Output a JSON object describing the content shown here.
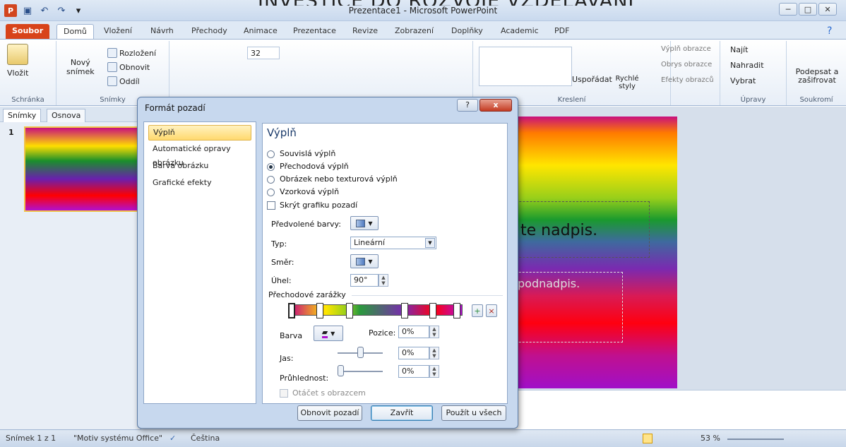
{
  "overlay": {
    "text": "INVESTICE DO ROZVOJE VZDĚLÁVÁNÍ"
  },
  "window": {
    "title": "Prezentace1 - Microsoft PowerPoint",
    "app_icon": "P"
  },
  "tabs": [
    {
      "label": "Soubor"
    },
    {
      "label": "Domů"
    },
    {
      "label": "Vložení"
    },
    {
      "label": "Návrh"
    },
    {
      "label": "Přechody"
    },
    {
      "label": "Animace"
    },
    {
      "label": "Prezentace"
    },
    {
      "label": "Revize"
    },
    {
      "label": "Zobrazení"
    },
    {
      "label": "Doplňky"
    },
    {
      "label": "Academic"
    },
    {
      "label": "PDF"
    }
  ],
  "ribbon": {
    "clipboard": {
      "paste": "Vložit",
      "group": "Schránka"
    },
    "slides": {
      "new_slide": "Nový\nsnímek",
      "layout": "Rozložení",
      "reset": "Obnovit",
      "section": "Oddíl",
      "group": "Snímky"
    },
    "font": {
      "size": "32"
    },
    "drawing": {
      "arrange": "Uspořádat",
      "quick_styles": "Rychlé styly",
      "fill": "Výplň obrazce",
      "outline": "Obrys obrazce",
      "effects": "Efekty obrazců",
      "group": "Kreslení"
    },
    "editing": {
      "find": "Najít",
      "replace": "Nahradit",
      "select": "Vybrat",
      "group": "Úpravy"
    },
    "privacy": {
      "sign": "Podepsat a zašifrovat",
      "group": "Soukromí"
    }
  },
  "left_pane": {
    "tab_slides": "Snímky",
    "tab_outline": "Osnova",
    "slide_number": "1"
  },
  "slide": {
    "title_placeholder": "te nadpis.",
    "subtitle_placeholder": "podnadpis."
  },
  "dialog": {
    "title": "Formát pozadí",
    "help": "?",
    "close": "x",
    "nav": [
      "Výplň",
      "Automatické opravy obrázku",
      "Barva obrázku",
      "Grafické efekty"
    ],
    "panel_heading": "Výplň",
    "fill_options": [
      "Souvislá výplň",
      "Přechodová výplň",
      "Obrázek nebo texturová výplň",
      "Vzorková výplň"
    ],
    "selected_fill": "Přechodová výplň",
    "hide_graphics": "Skrýt grafiku pozadí",
    "preset_label": "Předvolené barvy:",
    "type_label": "Typ:",
    "type_value": "Lineární",
    "direction_label": "Směr:",
    "angle_label": "Úhel:",
    "angle_value": "90°",
    "stops_label": "Přechodové zarážky",
    "color_label": "Barva",
    "position_label": "Pozice:",
    "position_value": "0%",
    "brightness_label": "Jas:",
    "brightness_value": "0%",
    "transparency_label": "Průhlednost:",
    "transparency_value": "0%",
    "rotate_label": "Otáčet s obrazcem",
    "reset_button": "Obnovit pozadí",
    "close_button": "Zavřít",
    "apply_all_button": "Použít u všech"
  },
  "status": {
    "slide": "Snímek 1 z 1",
    "theme": "\"Motiv systému Office\"",
    "language": "Čeština",
    "zoom": "53 %"
  },
  "colors": {
    "accent": "#d8431a",
    "ribbon": "#dfe9f5",
    "dialog": "#c7d8ee"
  }
}
